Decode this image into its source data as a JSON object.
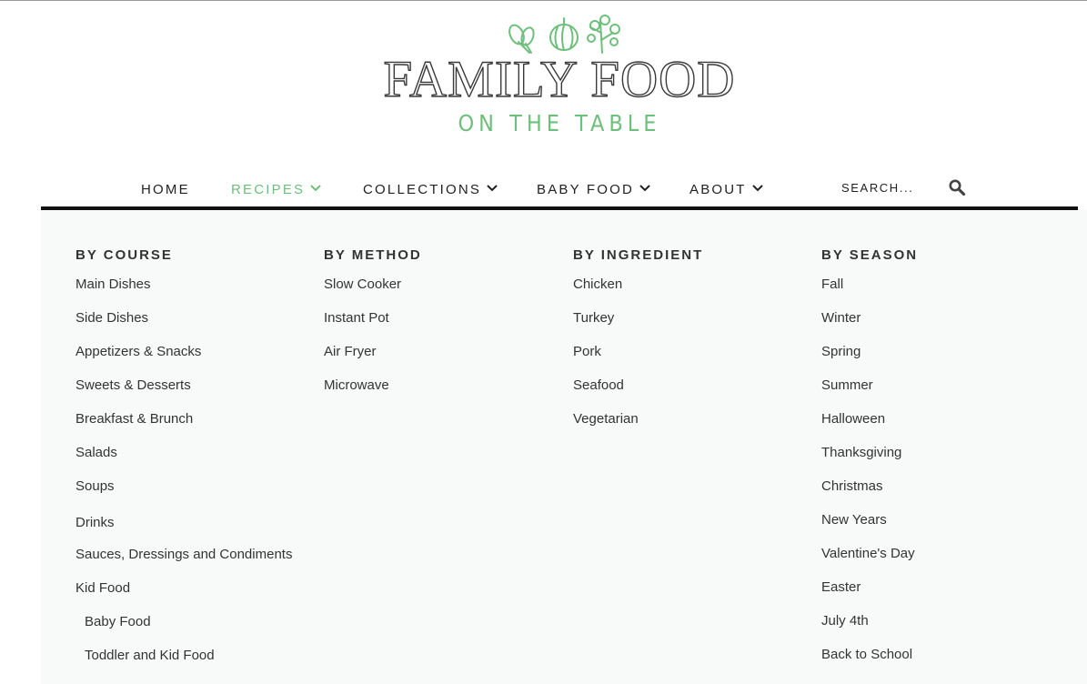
{
  "logo": {
    "title": "FAMILY FOOD",
    "subtitle": "ON THE TABLE",
    "brand_green": "#6fbf7c"
  },
  "nav": {
    "items": [
      {
        "label": "HOME"
      },
      {
        "label": "RECIPES"
      },
      {
        "label": "COLLECTIONS"
      },
      {
        "label": "BABY FOOD"
      },
      {
        "label": "ABOUT"
      }
    ],
    "search_placeholder": "SEARCH...",
    "search_icon": "search-icon",
    "chevron_icon": "chevron-down-icon"
  },
  "menu": {
    "course": {
      "heading": "BY COURSE",
      "links": [
        "Main Dishes",
        "Side Dishes",
        "Appetizers & Snacks",
        "Sweets & Desserts",
        "Breakfast & Brunch",
        "Salads",
        "Soups",
        "Drinks",
        "Sauces, Dressings and Condiments",
        "Kid Food",
        "Baby Food",
        "Toddler and Kid Food"
      ]
    },
    "method": {
      "heading": "BY METHOD",
      "links": [
        "Slow Cooker",
        "Instant Pot",
        "Air Fryer",
        "Microwave"
      ]
    },
    "ingredient": {
      "heading": "BY INGREDIENT",
      "links": [
        "Chicken",
        "Turkey",
        "Pork",
        "Seafood",
        "Vegetarian"
      ]
    },
    "season": {
      "heading": "BY SEASON",
      "links": [
        "Fall",
        "Winter",
        "Spring",
        "Summer",
        "Halloween",
        "Thanksgiving",
        "Christmas",
        "New Years",
        "Valentine's Day",
        "Easter",
        "July 4th",
        "Back to School"
      ]
    }
  }
}
